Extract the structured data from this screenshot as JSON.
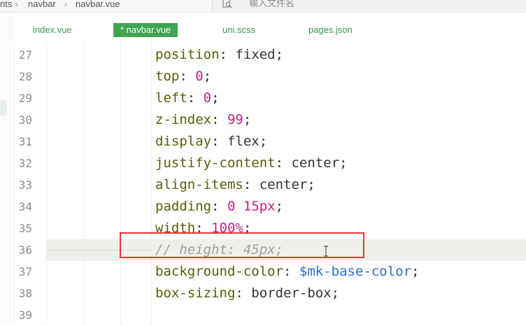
{
  "breadcrumb": {
    "items": [
      "nts",
      "navbar",
      "navbar.vue"
    ]
  },
  "file_search": {
    "placeholder": "输入文件名",
    "icon": "file-search-icon"
  },
  "tabs": [
    {
      "label": "index.vue",
      "active": false
    },
    {
      "label": "* navbar.vue",
      "active": true
    },
    {
      "label": "uni.scss",
      "active": false
    },
    {
      "label": "pages.json",
      "active": false
    }
  ],
  "editor": {
    "lines": [
      {
        "number": "27",
        "tokens": [
          [
            "prop",
            "position"
          ],
          [
            "punc",
            ": "
          ],
          [
            "val",
            "fixed"
          ],
          [
            "punc",
            ";"
          ]
        ]
      },
      {
        "number": "28",
        "tokens": [
          [
            "prop",
            "top"
          ],
          [
            "punc",
            ": "
          ],
          [
            "num",
            "0"
          ],
          [
            "punc",
            ";"
          ]
        ]
      },
      {
        "number": "29",
        "tokens": [
          [
            "prop",
            "left"
          ],
          [
            "punc",
            ": "
          ],
          [
            "num",
            "0"
          ],
          [
            "punc",
            ";"
          ]
        ]
      },
      {
        "number": "30",
        "tokens": [
          [
            "prop",
            "z-index"
          ],
          [
            "punc",
            ": "
          ],
          [
            "num",
            "99"
          ],
          [
            "punc",
            ";"
          ]
        ]
      },
      {
        "number": "31",
        "tokens": [
          [
            "prop",
            "display"
          ],
          [
            "punc",
            ": "
          ],
          [
            "val",
            "flex"
          ],
          [
            "punc",
            ";"
          ]
        ]
      },
      {
        "number": "32",
        "tokens": [
          [
            "prop",
            "justify-content"
          ],
          [
            "punc",
            ": "
          ],
          [
            "val",
            "center"
          ],
          [
            "punc",
            ";"
          ]
        ]
      },
      {
        "number": "33",
        "tokens": [
          [
            "prop",
            "align-items"
          ],
          [
            "punc",
            ": "
          ],
          [
            "val",
            "center"
          ],
          [
            "punc",
            ";"
          ]
        ]
      },
      {
        "number": "34",
        "tokens": [
          [
            "prop",
            "padding"
          ],
          [
            "punc",
            ": "
          ],
          [
            "num",
            "0 "
          ],
          [
            "num",
            "15px"
          ],
          [
            "punc",
            ";"
          ]
        ]
      },
      {
        "number": "35",
        "tokens": [
          [
            "prop",
            "width"
          ],
          [
            "punc",
            ": "
          ],
          [
            "num",
            "100%"
          ],
          [
            "punc",
            ";"
          ]
        ]
      },
      {
        "number": "36",
        "tokens": [
          [
            "comment",
            "// height: 45px;"
          ]
        ]
      },
      {
        "number": "37",
        "tokens": [
          [
            "prop",
            "background-color"
          ],
          [
            "punc",
            ": "
          ],
          [
            "var",
            "$mk-base-color"
          ],
          [
            "punc",
            ";"
          ]
        ]
      },
      {
        "number": "38",
        "tokens": [
          [
            "prop",
            "box-sizing"
          ],
          [
            "punc",
            ": "
          ],
          [
            "val",
            "border-box"
          ],
          [
            "punc",
            ";"
          ]
        ]
      },
      {
        "number": "39",
        "tokens": []
      }
    ],
    "current_line": "36"
  },
  "colors": {
    "accent": "#3fa551",
    "highlight_border": "#e53935"
  }
}
